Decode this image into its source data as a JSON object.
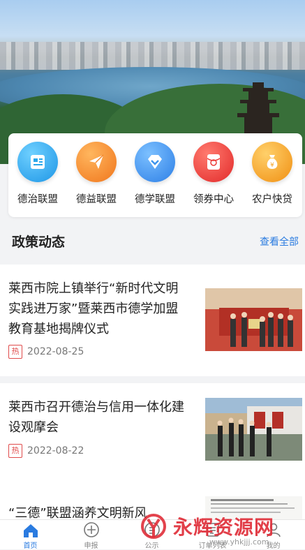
{
  "quick_links": [
    {
      "label": "德治联盟",
      "icon": "document-icon",
      "color": "#29a7ea"
    },
    {
      "label": "德益联盟",
      "icon": "paper-plane-icon",
      "color": "#f3862a"
    },
    {
      "label": "德学联盟",
      "icon": "diamond-icon",
      "color": "#3f95ee"
    },
    {
      "label": "领券中心",
      "icon": "red-envelope-icon",
      "color": "#ec3c38"
    },
    {
      "label": "农户快贷",
      "icon": "money-bag-icon",
      "color": "#f4a225"
    }
  ],
  "section": {
    "title": "政策动态",
    "more": "查看全部"
  },
  "news": [
    {
      "title": "莱西市院上镇举行“新时代文明实践进万家”暨莱西市德学加盟教育基地揭牌仪式",
      "tag": "热",
      "date": "2022-08-25"
    },
    {
      "title": "莱西市召开德治与信用一体化建设观摩会",
      "tag": "热",
      "date": "2022-08-22"
    },
    {
      "title": "“三德”联盟涵养文明新风"
    }
  ],
  "tabs": [
    {
      "label": "首页",
      "icon": "home-icon",
      "active": true
    },
    {
      "label": "申报",
      "icon": "plus-circle-icon"
    },
    {
      "label": "公示",
      "icon": "notice-icon"
    },
    {
      "label": "订单列表",
      "icon": "list-icon"
    },
    {
      "label": "我的",
      "icon": "user-icon"
    }
  ],
  "watermark": {
    "text": "永辉资源网",
    "url": "www.yhkjjj.com"
  },
  "colors": {
    "accent": "#2a7be0",
    "hot": "#e04b4b"
  }
}
